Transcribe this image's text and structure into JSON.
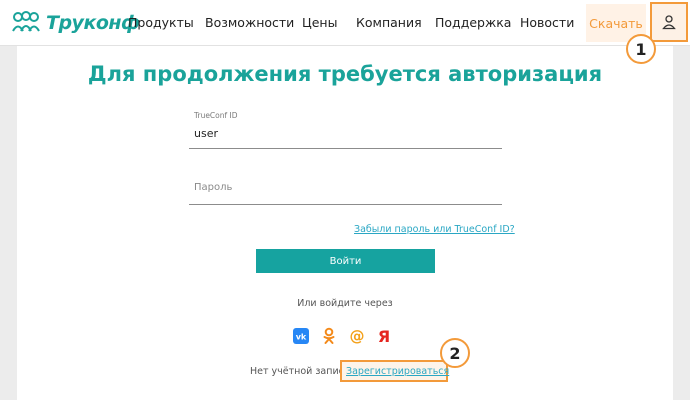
{
  "header": {
    "logo_text": "Труконф",
    "nav": [
      "Продукты",
      "Возможности",
      "Цены",
      "Компания",
      "Поддержка",
      "Новости"
    ],
    "download_label": "Скачать"
  },
  "login": {
    "title": "Для продолжения требуется авторизация",
    "id_label": "TrueConf ID",
    "id_value": "user",
    "password_placeholder": "Пароль",
    "forgot_link": "Забыли пароль или TrueConf ID?",
    "submit_label": "Войти",
    "or_text": "Или войдите через",
    "social": [
      "vk-icon",
      "odnoklassniki-icon",
      "mailru-icon",
      "yandex-icon"
    ],
    "no_account_text": "Нет учётной записи?",
    "register_link": "Зарегистрироваться"
  },
  "callouts": [
    "1",
    "2"
  ],
  "colors": {
    "accent": "#1aa39a",
    "highlight": "#f39a3a",
    "link": "#2aa7c4",
    "button": "#16a3a0"
  }
}
